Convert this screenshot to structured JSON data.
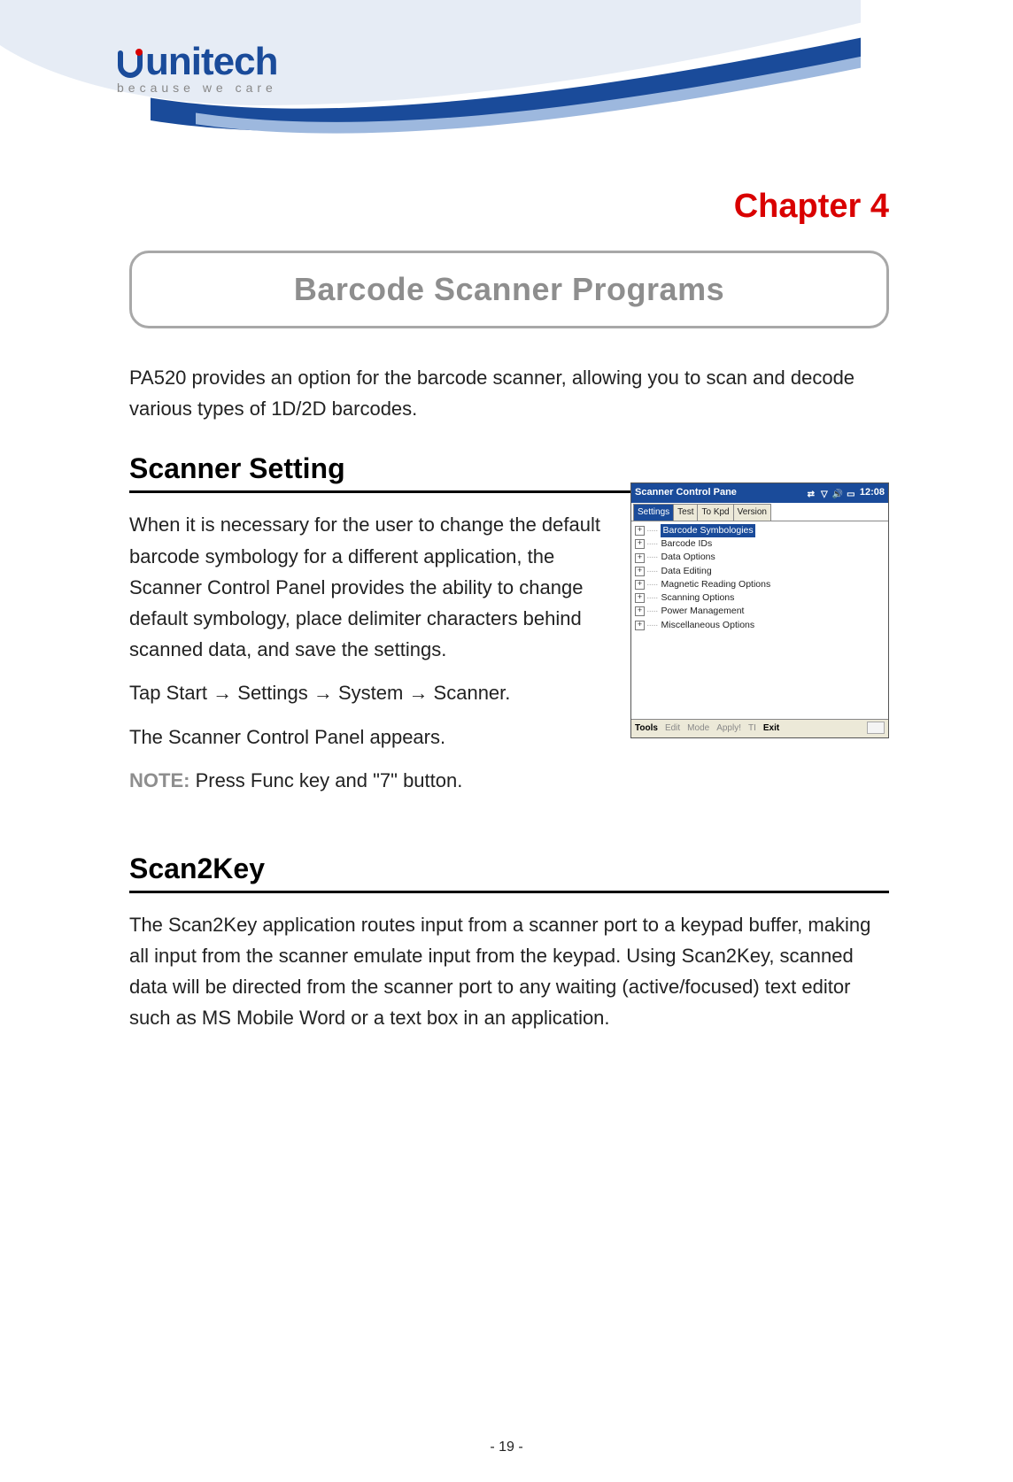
{
  "logo": {
    "brand": "unitech",
    "tagline": "because we care"
  },
  "chapter_heading": "Chapter 4",
  "main_title": "Barcode Scanner Programs",
  "intro_paragraph": "PA520 provides an option for the barcode scanner, allowing you to scan and decode various types of 1D/2D barcodes.",
  "section1": {
    "heading": "Scanner Setting",
    "paragraph1": "When it is necessary for the user to change the default barcode symbology for a different application, the Scanner Control Panel provides the ability to change default symbology, place delimiter characters behind scanned data, and save the settings.",
    "paragraph2": "Tap Start → Settings → System → Scanner.",
    "paragraph3": "The Scanner Control Panel appears.",
    "note_label": "NOTE:",
    "note_text": " Press Func key and \"7\" button."
  },
  "screenshot": {
    "window_title": "Scanner Control Pane",
    "clock": "12:08",
    "tabs": [
      "Settings",
      "Test",
      "To Kpd",
      "Version"
    ],
    "active_tab_index": 0,
    "tree_items": [
      "Barcode Symbologies",
      "Barcode IDs",
      "Data Options",
      "Data Editing",
      "Magnetic Reading Options",
      "Scanning Options",
      "Power Management",
      "Miscellaneous Options"
    ],
    "selected_tree_index": 0,
    "menubar": [
      "Tools",
      "Edit",
      "Mode",
      "Apply!",
      "TI",
      "Exit"
    ]
  },
  "section2": {
    "heading": "Scan2Key",
    "paragraph": "The Scan2Key application routes input from a scanner port to a keypad buffer, making all input from the scanner emulate input from the keypad. Using Scan2Key, scanned data will be directed from the scanner port to any waiting (active/focused) text editor such as MS Mobile Word or a text box in an application."
  },
  "page_number": "- 19 -"
}
